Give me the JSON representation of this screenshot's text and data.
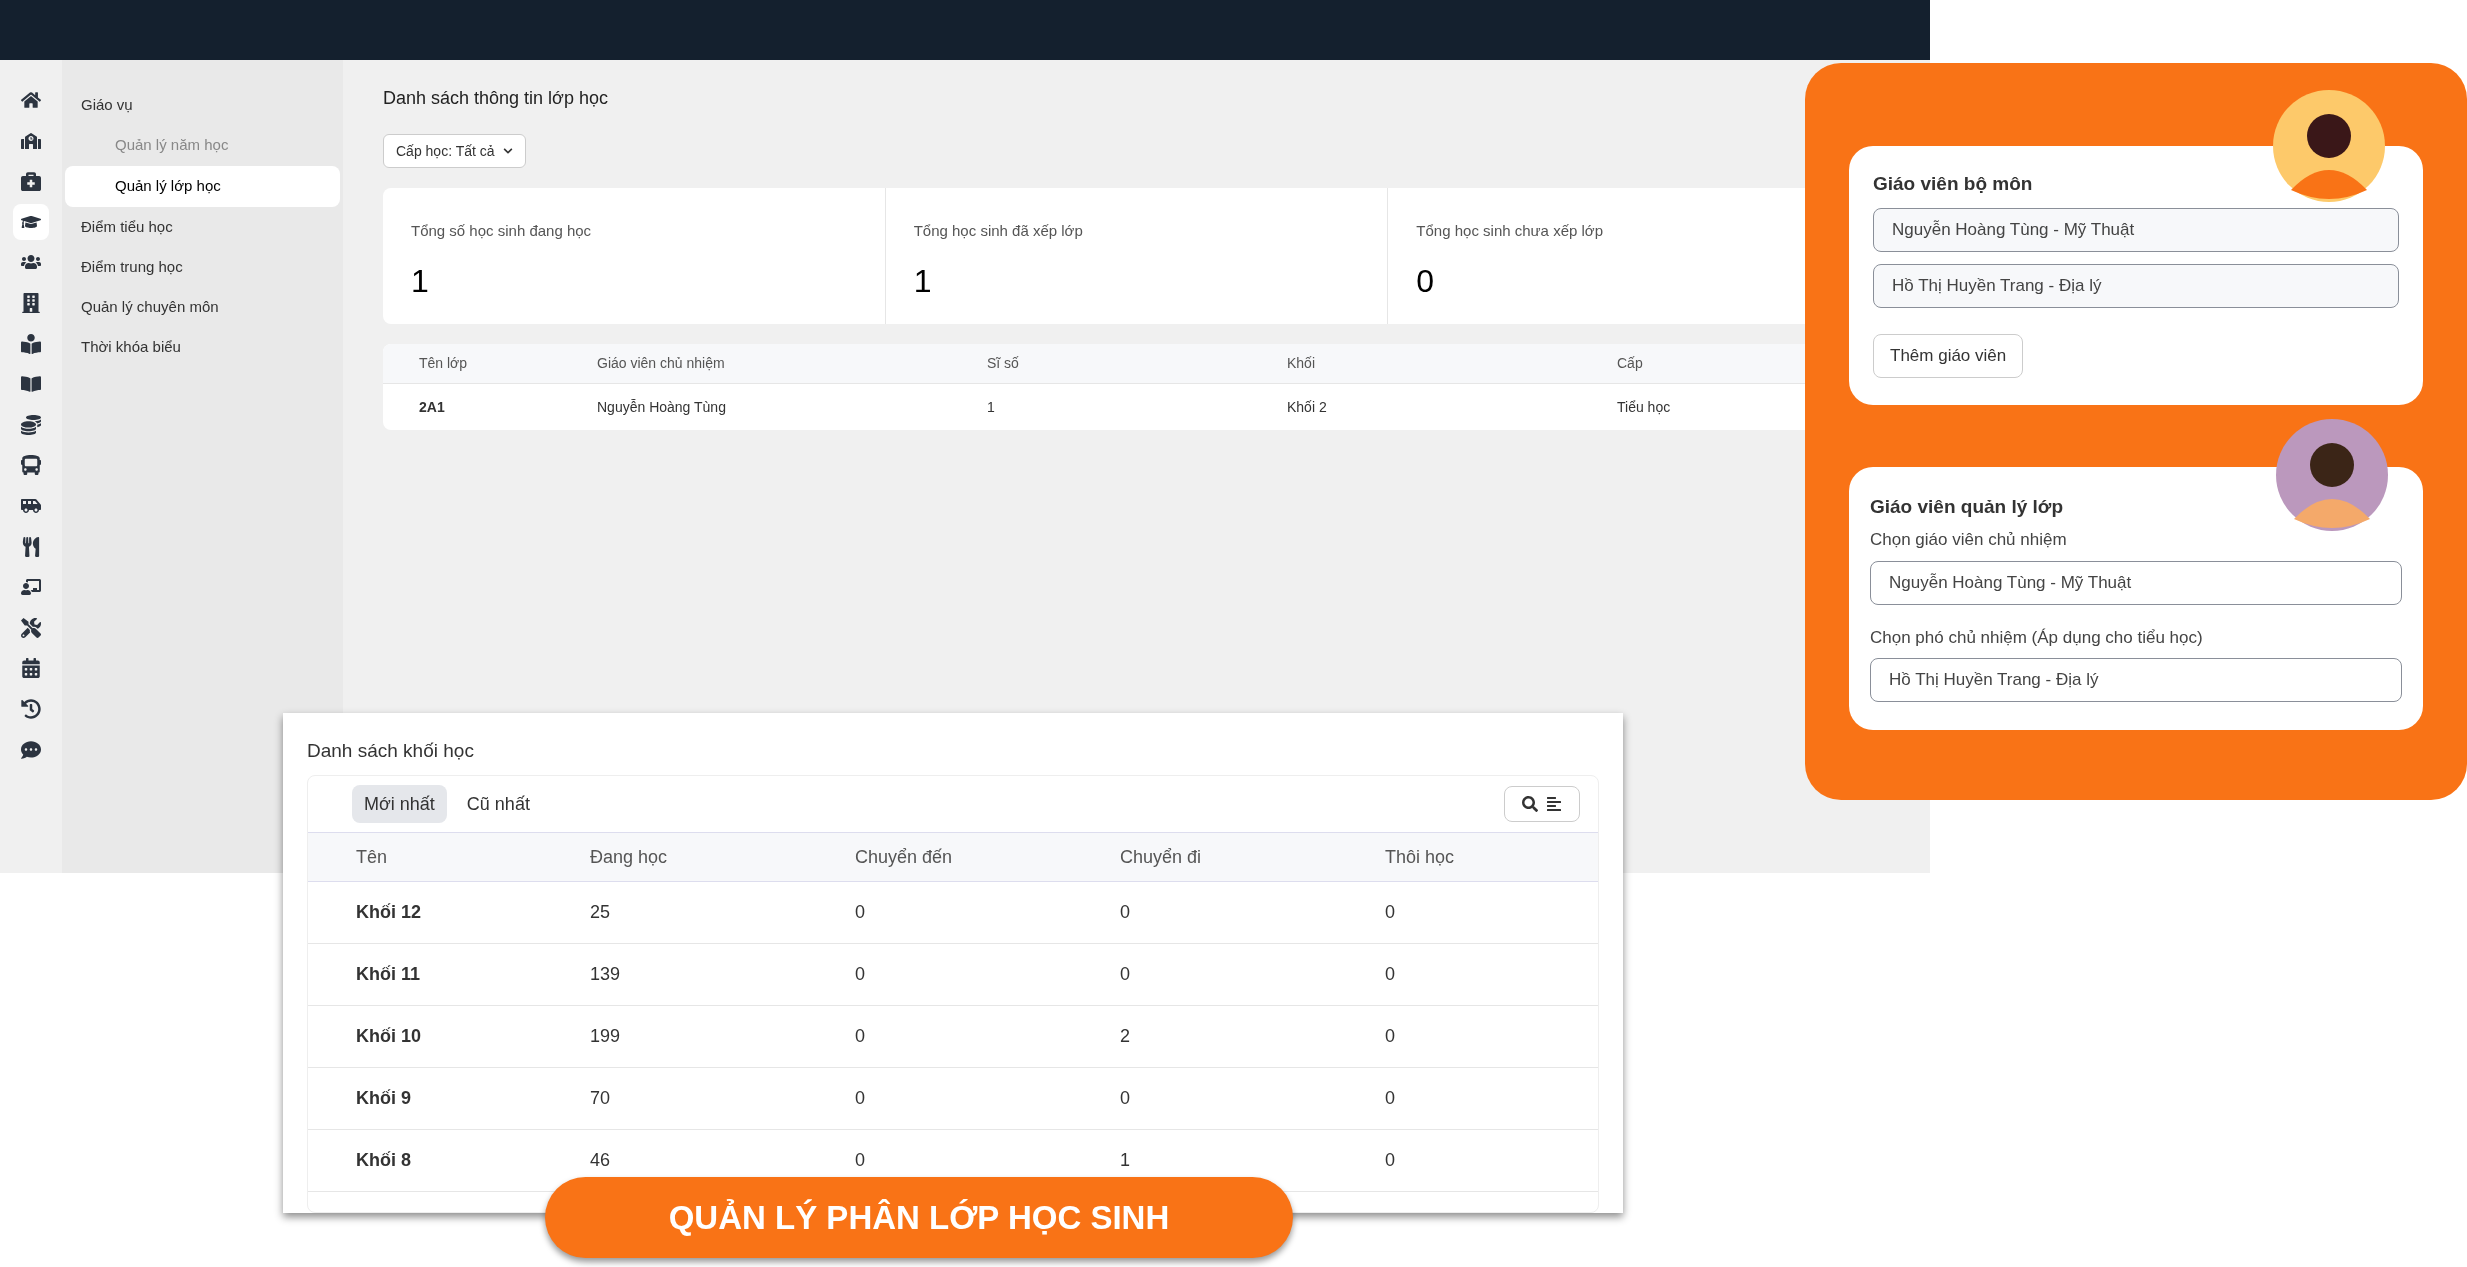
{
  "rail": [
    {
      "selected": false
    },
    {
      "selected": false
    },
    {
      "selected": false
    },
    {
      "selected": true
    },
    {
      "selected": false
    },
    {
      "selected": false
    },
    {
      "selected": false
    },
    {
      "selected": false
    },
    {
      "selected": false
    },
    {
      "selected": false
    },
    {
      "selected": false
    },
    {
      "selected": false
    },
    {
      "selected": false
    },
    {
      "selected": false
    },
    {
      "selected": false
    },
    {
      "selected": false
    },
    {
      "selected": false
    }
  ],
  "submenu": [
    {
      "label": "Giáo vụ",
      "selected": false,
      "children": [
        {
          "label": "Quản lý năm học",
          "selected": false
        },
        {
          "label": "Quản lý lớp học",
          "selected": true
        }
      ]
    },
    {
      "label": "Điểm tiểu học",
      "selected": false
    },
    {
      "label": "Điểm trung học",
      "selected": false
    },
    {
      "label": "Quản lý chuyên môn",
      "selected": false
    },
    {
      "label": "Thời khóa biểu",
      "selected": false
    }
  ],
  "page_title": "Danh sách thông tin lớp học",
  "filter": "Cấp học: Tất cả",
  "stats": [
    {
      "label": "Tổng số học sinh đang học",
      "value": "1"
    },
    {
      "label": "Tổng học sinh đã xếp lớp",
      "value": "1"
    },
    {
      "label": "Tổng học sinh chưa xếp lớp",
      "value": "0"
    }
  ],
  "class_table": {
    "columns": [
      "Tên lớp",
      "Giáo viên chủ nhiệm",
      "Sĩ số",
      "Khối",
      "Cấp"
    ],
    "rows": [
      [
        "2A1",
        "Nguyễn Hoàng Tùng",
        "1",
        "Khối 2",
        "Tiểu học"
      ]
    ]
  },
  "grade_panel": {
    "title": "Danh sách khối học",
    "tabs": [
      {
        "label": "Mới nhất",
        "selected": true
      },
      {
        "label": "Cũ nhất",
        "selected": false
      }
    ],
    "columns": [
      "Tên",
      "Đang học",
      "Chuyển đến",
      "Chuyển đi",
      "Thôi học"
    ],
    "rows": [
      [
        "Khối 12",
        "25",
        "0",
        "0",
        "0"
      ],
      [
        "Khối 11",
        "139",
        "0",
        "0",
        "0"
      ],
      [
        "Khối 10",
        "199",
        "0",
        "2",
        "0"
      ],
      [
        "Khối 9",
        "70",
        "0",
        "0",
        "0"
      ],
      [
        "Khối 8",
        "46",
        "0",
        "1",
        "0"
      ]
    ]
  },
  "subject_teachers": {
    "title": "Giáo viên bộ môn",
    "values": [
      "Nguyễn Hoàng Tùng - Mỹ Thuật",
      "Hồ Thị Huyền Trang - Địa lý"
    ],
    "button": "Thêm giáo viên"
  },
  "class_managers": {
    "title": "Giáo viên quản lý lớp",
    "fields": [
      {
        "label": "Chọn giáo viên chủ nhiệm",
        "value": "Nguyễn Hoàng Tùng - Mỹ Thuật"
      },
      {
        "label": "Chọn phó chủ nhiệm (Áp dụng cho tiểu học)",
        "value": "Hồ Thị Huyền Trang - Địa lý"
      }
    ]
  },
  "banner": "QUẢN LÝ PHÂN LỚP HỌC SINH"
}
